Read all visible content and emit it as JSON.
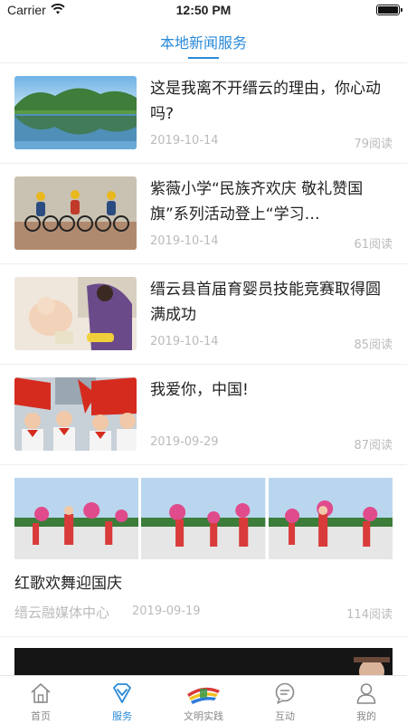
{
  "status_bar": {
    "carrier": "Carrier",
    "time": "12:50 PM"
  },
  "header": {
    "title": "本地新闻服务",
    "accent_color": "#2a8ad8"
  },
  "news": [
    {
      "title": "这是我离不开缙云的理由，你心动吗?",
      "date": "2019-10-14",
      "reads": "79阅读",
      "image": "lake-mountain-scene"
    },
    {
      "title": "紫薇小学“民族齐欢庆 敬礼赞国旗”系列活动登上“学习…",
      "date": "2019-10-14",
      "reads": "61阅读",
      "image": "cyclists-race"
    },
    {
      "title": "缙云县首届育婴员技能竞赛取得圆满成功",
      "date": "2019-10-14",
      "reads": "85阅读",
      "image": "baby-care-contest"
    },
    {
      "title": "我爱你，中国!",
      "date": "2019-09-29",
      "reads": "87阅读",
      "image": "children-with-flags"
    }
  ],
  "gallery_item": {
    "title": "红歌欢舞迎国庆",
    "source": "缙云融媒体中心",
    "date": "2019-09-19",
    "reads": "114阅读",
    "images": [
      "fan-dance-1",
      "fan-dance-2",
      "fan-dance-3"
    ]
  },
  "tabs": [
    {
      "label": "首页",
      "icon": "home-icon",
      "active": false
    },
    {
      "label": "服务",
      "icon": "diamond-icon",
      "active": true
    },
    {
      "label": "文明实践",
      "icon": "civilization-logo-icon",
      "active": false
    },
    {
      "label": "互动",
      "icon": "chat-icon",
      "active": false
    },
    {
      "label": "我的",
      "icon": "user-icon",
      "active": false
    }
  ]
}
